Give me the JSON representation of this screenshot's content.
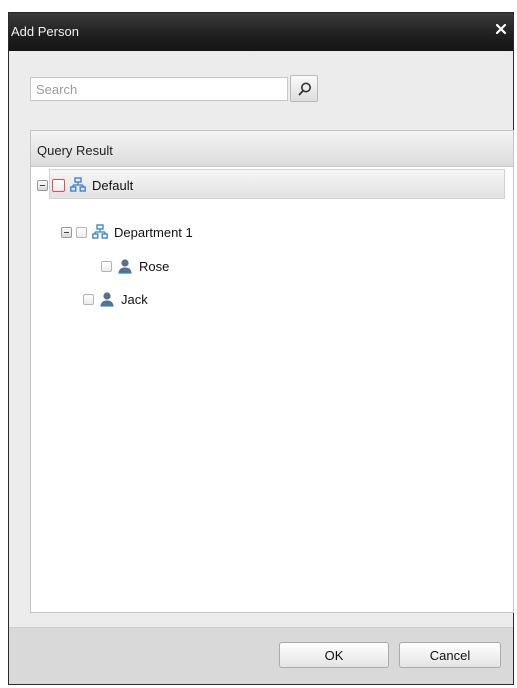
{
  "dialog": {
    "title": "Add Person",
    "close_icon": "close-icon"
  },
  "search": {
    "placeholder": "Search",
    "value": "",
    "button_icon": "search-icon"
  },
  "panel": {
    "header": "Query Result"
  },
  "tree": {
    "root": {
      "label": "Default",
      "icon": "organization-icon",
      "expanded": true,
      "checked": false
    },
    "department": {
      "label": "Department 1",
      "icon": "organization-icon",
      "expanded": true,
      "checked": false
    },
    "rose": {
      "label": "Rose",
      "icon": "person-icon",
      "checked": false
    },
    "jack": {
      "label": "Jack",
      "icon": "person-icon",
      "checked": false
    }
  },
  "buttons": {
    "ok": "OK",
    "cancel": "Cancel"
  },
  "colors": {
    "titlebar": "#1f1f1f",
    "org_icon": "#2f7fd1",
    "person_icon": "#5a6f8a",
    "selected_checkbox_border": "#e05050"
  }
}
